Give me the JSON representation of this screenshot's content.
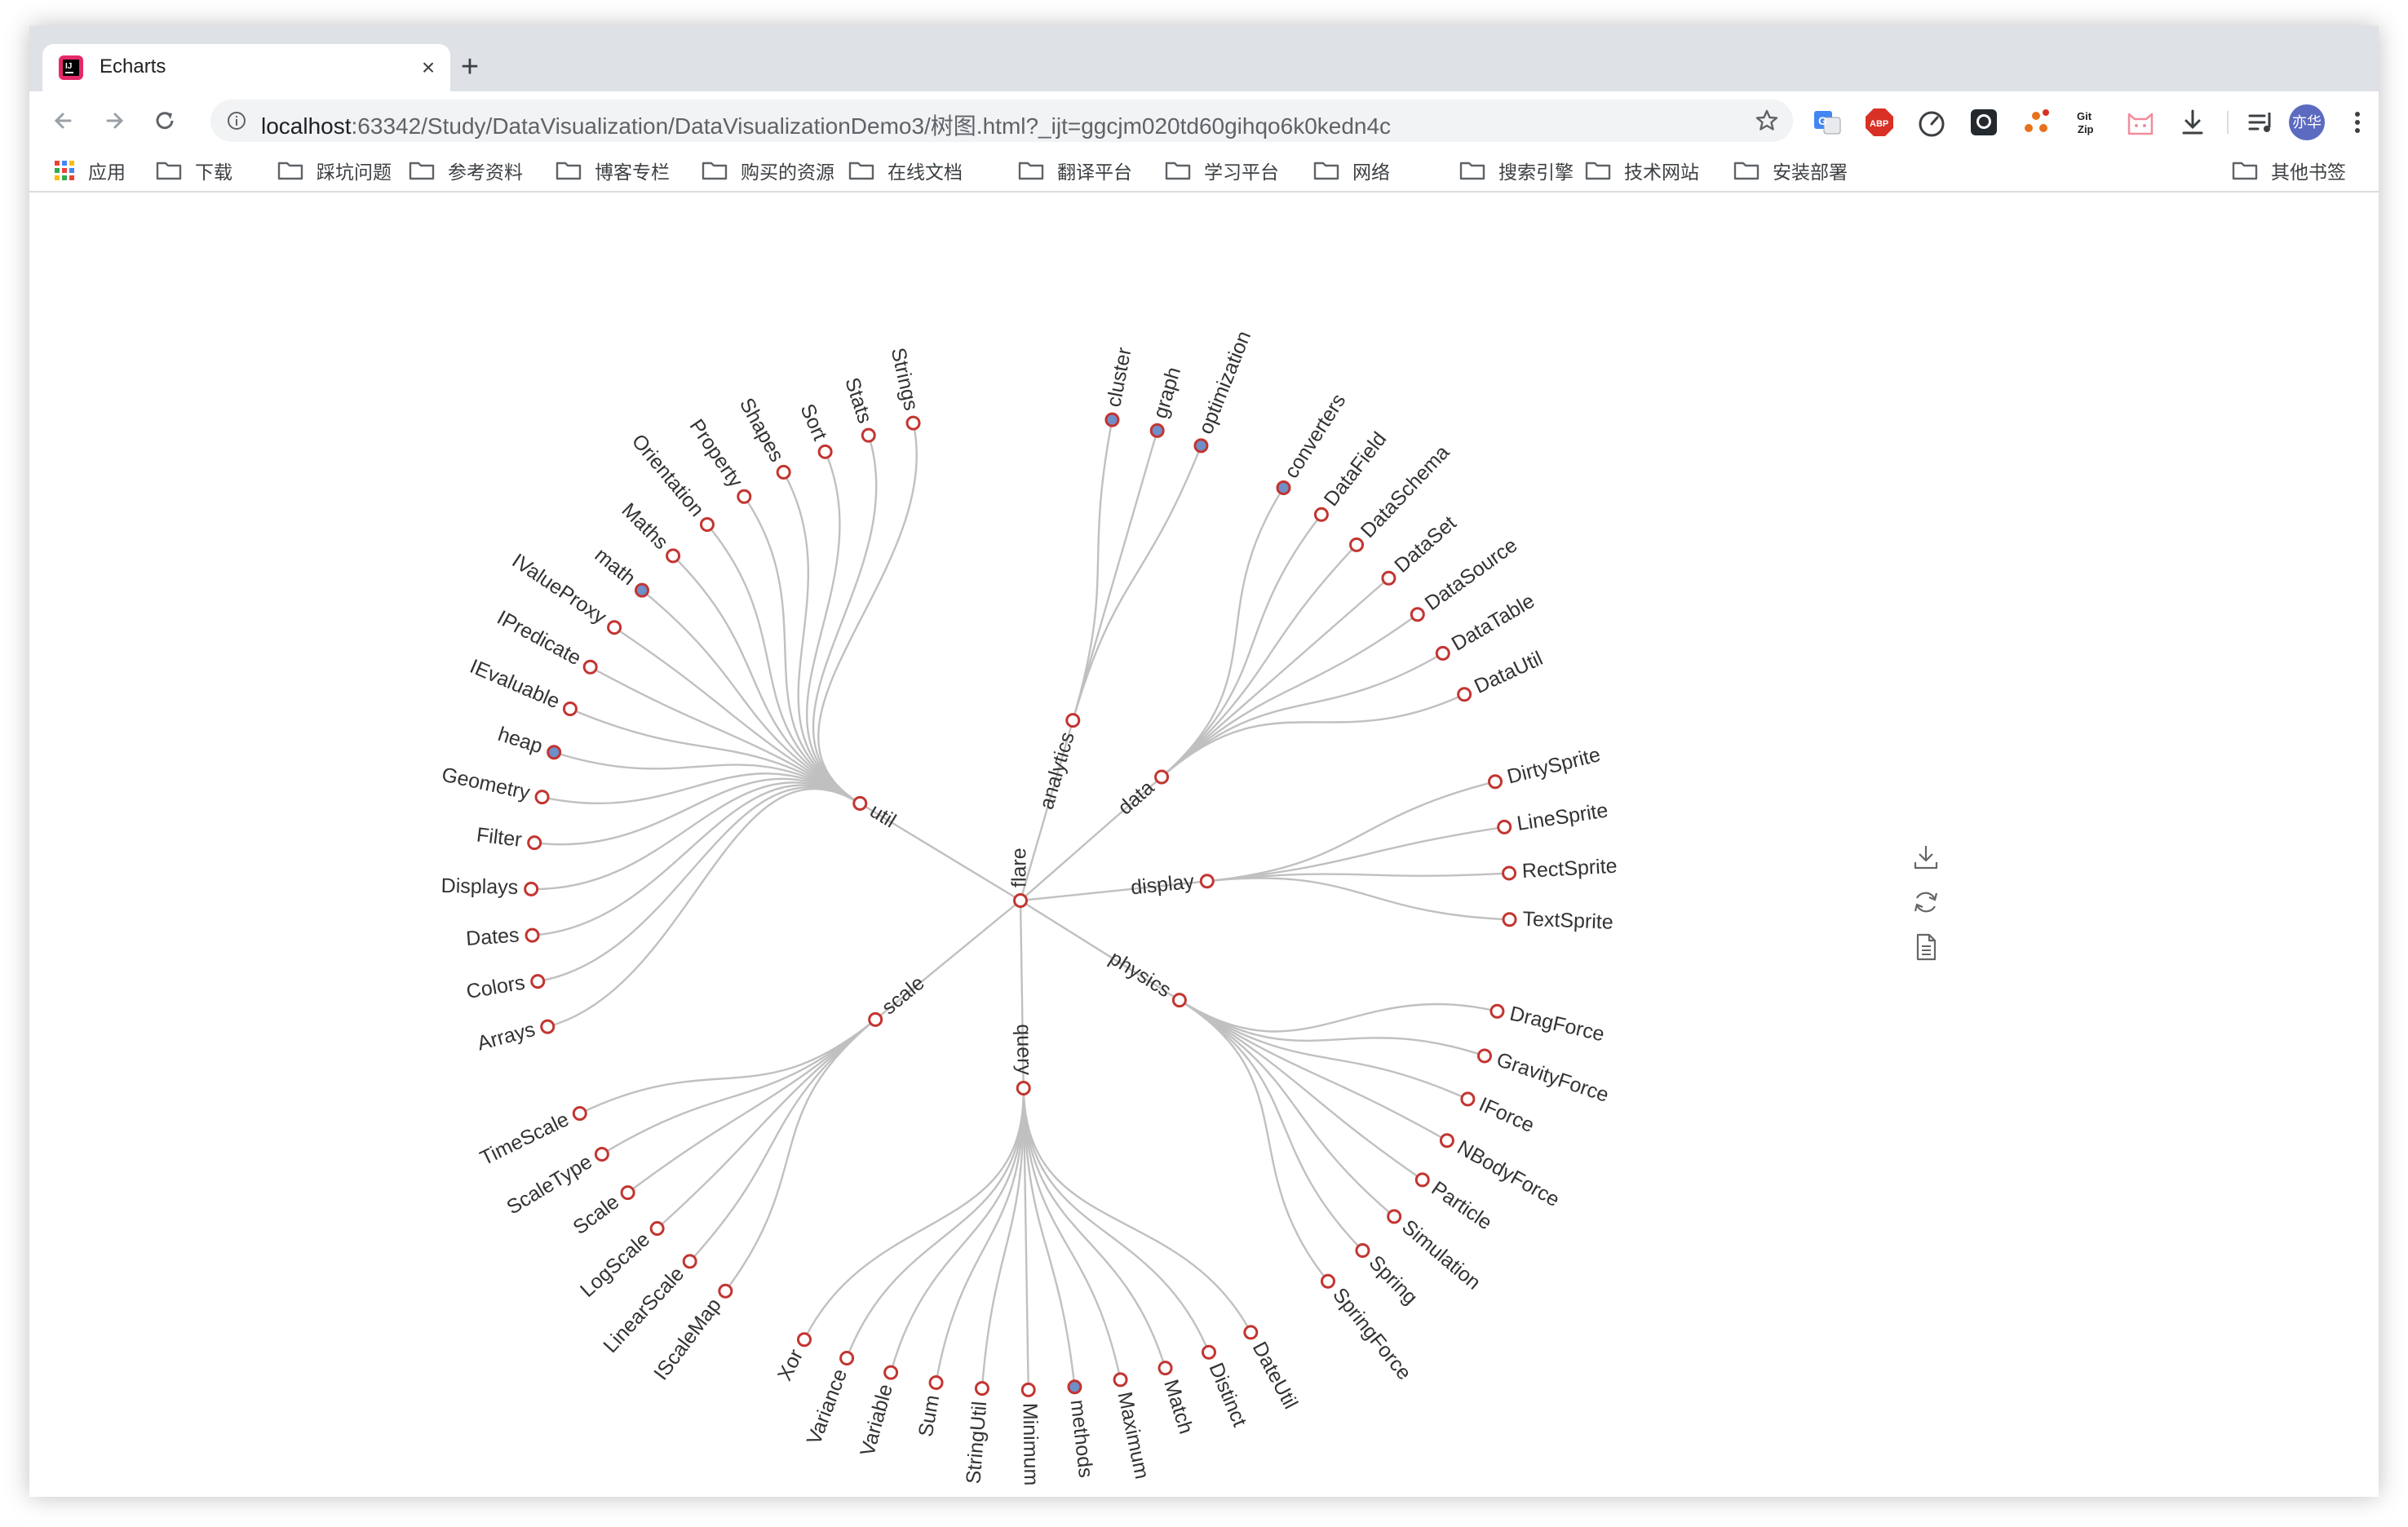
{
  "tab": {
    "title": "Echarts",
    "close": "×",
    "new_tab": "+"
  },
  "address": {
    "host": "localhost",
    "path": ":63342/Study/DataVisualization/DataVisualizationDemo3/树图.html?_ijt=ggcjm020td60gihqo6k0kedn4c"
  },
  "extensions": [
    "translate-icon",
    "adblock-icon",
    "speed-icon",
    "github-icon",
    "ext-icon",
    "gitzip-icon",
    "cat-icon",
    "download-icon"
  ],
  "profile": {
    "label": "亦华"
  },
  "bookmarks": {
    "apps": "应用",
    "items": [
      "下载",
      "踩坑问题",
      "参考资料",
      "博客专栏",
      "购买的资源",
      "在线文档",
      "翻译平台",
      "学习平台",
      "网络",
      "搜索引擎",
      "技术网站",
      "安装部署"
    ],
    "other": "其他书签"
  },
  "colors": {
    "node_border": "#c23531",
    "collapsed_fill": "#6f8fc9",
    "edge": "#c0c0c0"
  },
  "chart_data": {
    "type": "tree",
    "layout": "radial",
    "tree": {
      "name": "flare",
      "children": [
        {
          "name": "analytics",
          "collapsed": false,
          "children": [
            {
              "name": "cluster",
              "collapsed": true
            },
            {
              "name": "graph",
              "collapsed": true
            },
            {
              "name": "optimization",
              "collapsed": true
            }
          ]
        },
        {
          "name": "data",
          "collapsed": false,
          "children": [
            {
              "name": "converters",
              "collapsed": true
            },
            {
              "name": "DataField"
            },
            {
              "name": "DataSchema"
            },
            {
              "name": "DataSet"
            },
            {
              "name": "DataSource"
            },
            {
              "name": "DataTable"
            },
            {
              "name": "DataUtil"
            }
          ]
        },
        {
          "name": "display",
          "collapsed": false,
          "children": [
            {
              "name": "DirtySprite"
            },
            {
              "name": "LineSprite"
            },
            {
              "name": "RectSprite"
            },
            {
              "name": "TextSprite"
            }
          ]
        },
        {
          "name": "physics",
          "collapsed": false,
          "children": [
            {
              "name": "DragForce"
            },
            {
              "name": "GravityForce"
            },
            {
              "name": "IForce"
            },
            {
              "name": "NBodyForce"
            },
            {
              "name": "Particle"
            },
            {
              "name": "Simulation"
            },
            {
              "name": "Spring"
            },
            {
              "name": "SpringForce"
            }
          ]
        },
        {
          "name": "query",
          "collapsed": false,
          "children": [
            {
              "name": "DateUtil"
            },
            {
              "name": "Distinct"
            },
            {
              "name": "Match"
            },
            {
              "name": "Maximum"
            },
            {
              "name": "methods",
              "collapsed": true
            },
            {
              "name": "Minimum"
            },
            {
              "name": "StringUtil"
            },
            {
              "name": "Sum"
            },
            {
              "name": "Variable"
            },
            {
              "name": "Variance"
            },
            {
              "name": "Xor"
            }
          ]
        },
        {
          "name": "scale",
          "collapsed": false,
          "children": [
            {
              "name": "IScaleMap"
            },
            {
              "name": "LinearScale"
            },
            {
              "name": "LogScale"
            },
            {
              "name": "Scale"
            },
            {
              "name": "ScaleType"
            },
            {
              "name": "TimeScale"
            }
          ]
        },
        {
          "name": "util",
          "collapsed": false,
          "children": [
            {
              "name": "Arrays"
            },
            {
              "name": "Colors"
            },
            {
              "name": "Dates"
            },
            {
              "name": "Displays"
            },
            {
              "name": "Filter"
            },
            {
              "name": "Geometry"
            },
            {
              "name": "heap",
              "collapsed": true
            },
            {
              "name": "IEvaluable"
            },
            {
              "name": "IPredicate"
            },
            {
              "name": "IValueProxy"
            },
            {
              "name": "math",
              "collapsed": true
            },
            {
              "name": "Maths"
            },
            {
              "name": "Orientation"
            },
            {
              "name": "Property"
            },
            {
              "name": "Shapes"
            },
            {
              "name": "Sort"
            },
            {
              "name": "Stats"
            },
            {
              "name": "Strings"
            }
          ]
        }
      ]
    },
    "toolbox": [
      "save-as-image",
      "restore",
      "data-view"
    ]
  }
}
